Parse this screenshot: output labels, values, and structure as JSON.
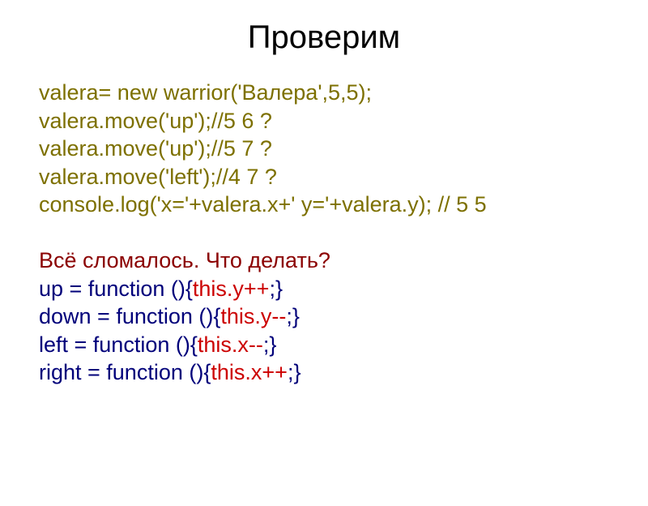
{
  "title": "Проверим",
  "lines": {
    "l1": "valera= new warrior('Валера',5,5);",
    "l2": "valera.move('up');//5 6 ?",
    "l3": "valera.move('up');//5 7 ?",
    "l4": "valera.move('left');//4 7 ?",
    "l5": "console.log('x='+valera.x+' y='+valera.y); // 5 5",
    "l6": "Всё сломалось. Что делать?",
    "l7a": "up = function (){",
    "l7b": "this.y++",
    "l7c": ";}",
    "l8a": "down = function (){",
    "l8b": "this.y--",
    "l8c": ";}",
    "l9a": "left = function (){",
    "l9b": "this.x--",
    "l9c": ";}",
    "l10a": "right = function (){",
    "l10b": "this.x++",
    "l10c": ";}"
  }
}
